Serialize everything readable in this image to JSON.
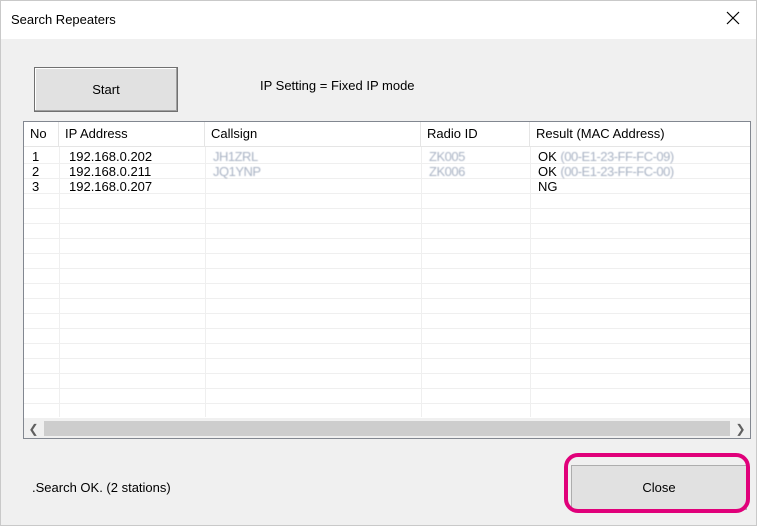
{
  "window": {
    "title": "Search Repeaters"
  },
  "toolbar": {
    "start_label": "Start",
    "ip_setting": "IP Setting = Fixed IP mode"
  },
  "table": {
    "columns": [
      "No",
      "IP Address",
      "Callsign",
      "Radio ID",
      "Result (MAC Address)"
    ],
    "rows": [
      {
        "no": "1",
        "ip": "192.168.0.202",
        "callsign": "JH1ZRL",
        "radio_id": "ZK005",
        "result_prefix": "OK",
        "mac": "(00-E1-23-FF-FC-09)"
      },
      {
        "no": "2",
        "ip": "192.168.0.211",
        "callsign": "JQ1YNP",
        "radio_id": "ZK006",
        "result_prefix": "OK",
        "mac": "(00-E1-23-FF-FC-00)"
      },
      {
        "no": "3",
        "ip": "192.168.0.207",
        "callsign": "",
        "radio_id": "",
        "result_prefix": "NG",
        "mac": ""
      }
    ]
  },
  "status": {
    "text": ".Search OK. (2 stations)"
  },
  "footer": {
    "close_label": "Close"
  },
  "colors": {
    "highlight": "#e0007a"
  },
  "icons": {
    "close": "close-icon",
    "scroll_left": "chevron-left-icon",
    "scroll_right": "chevron-right-icon"
  }
}
